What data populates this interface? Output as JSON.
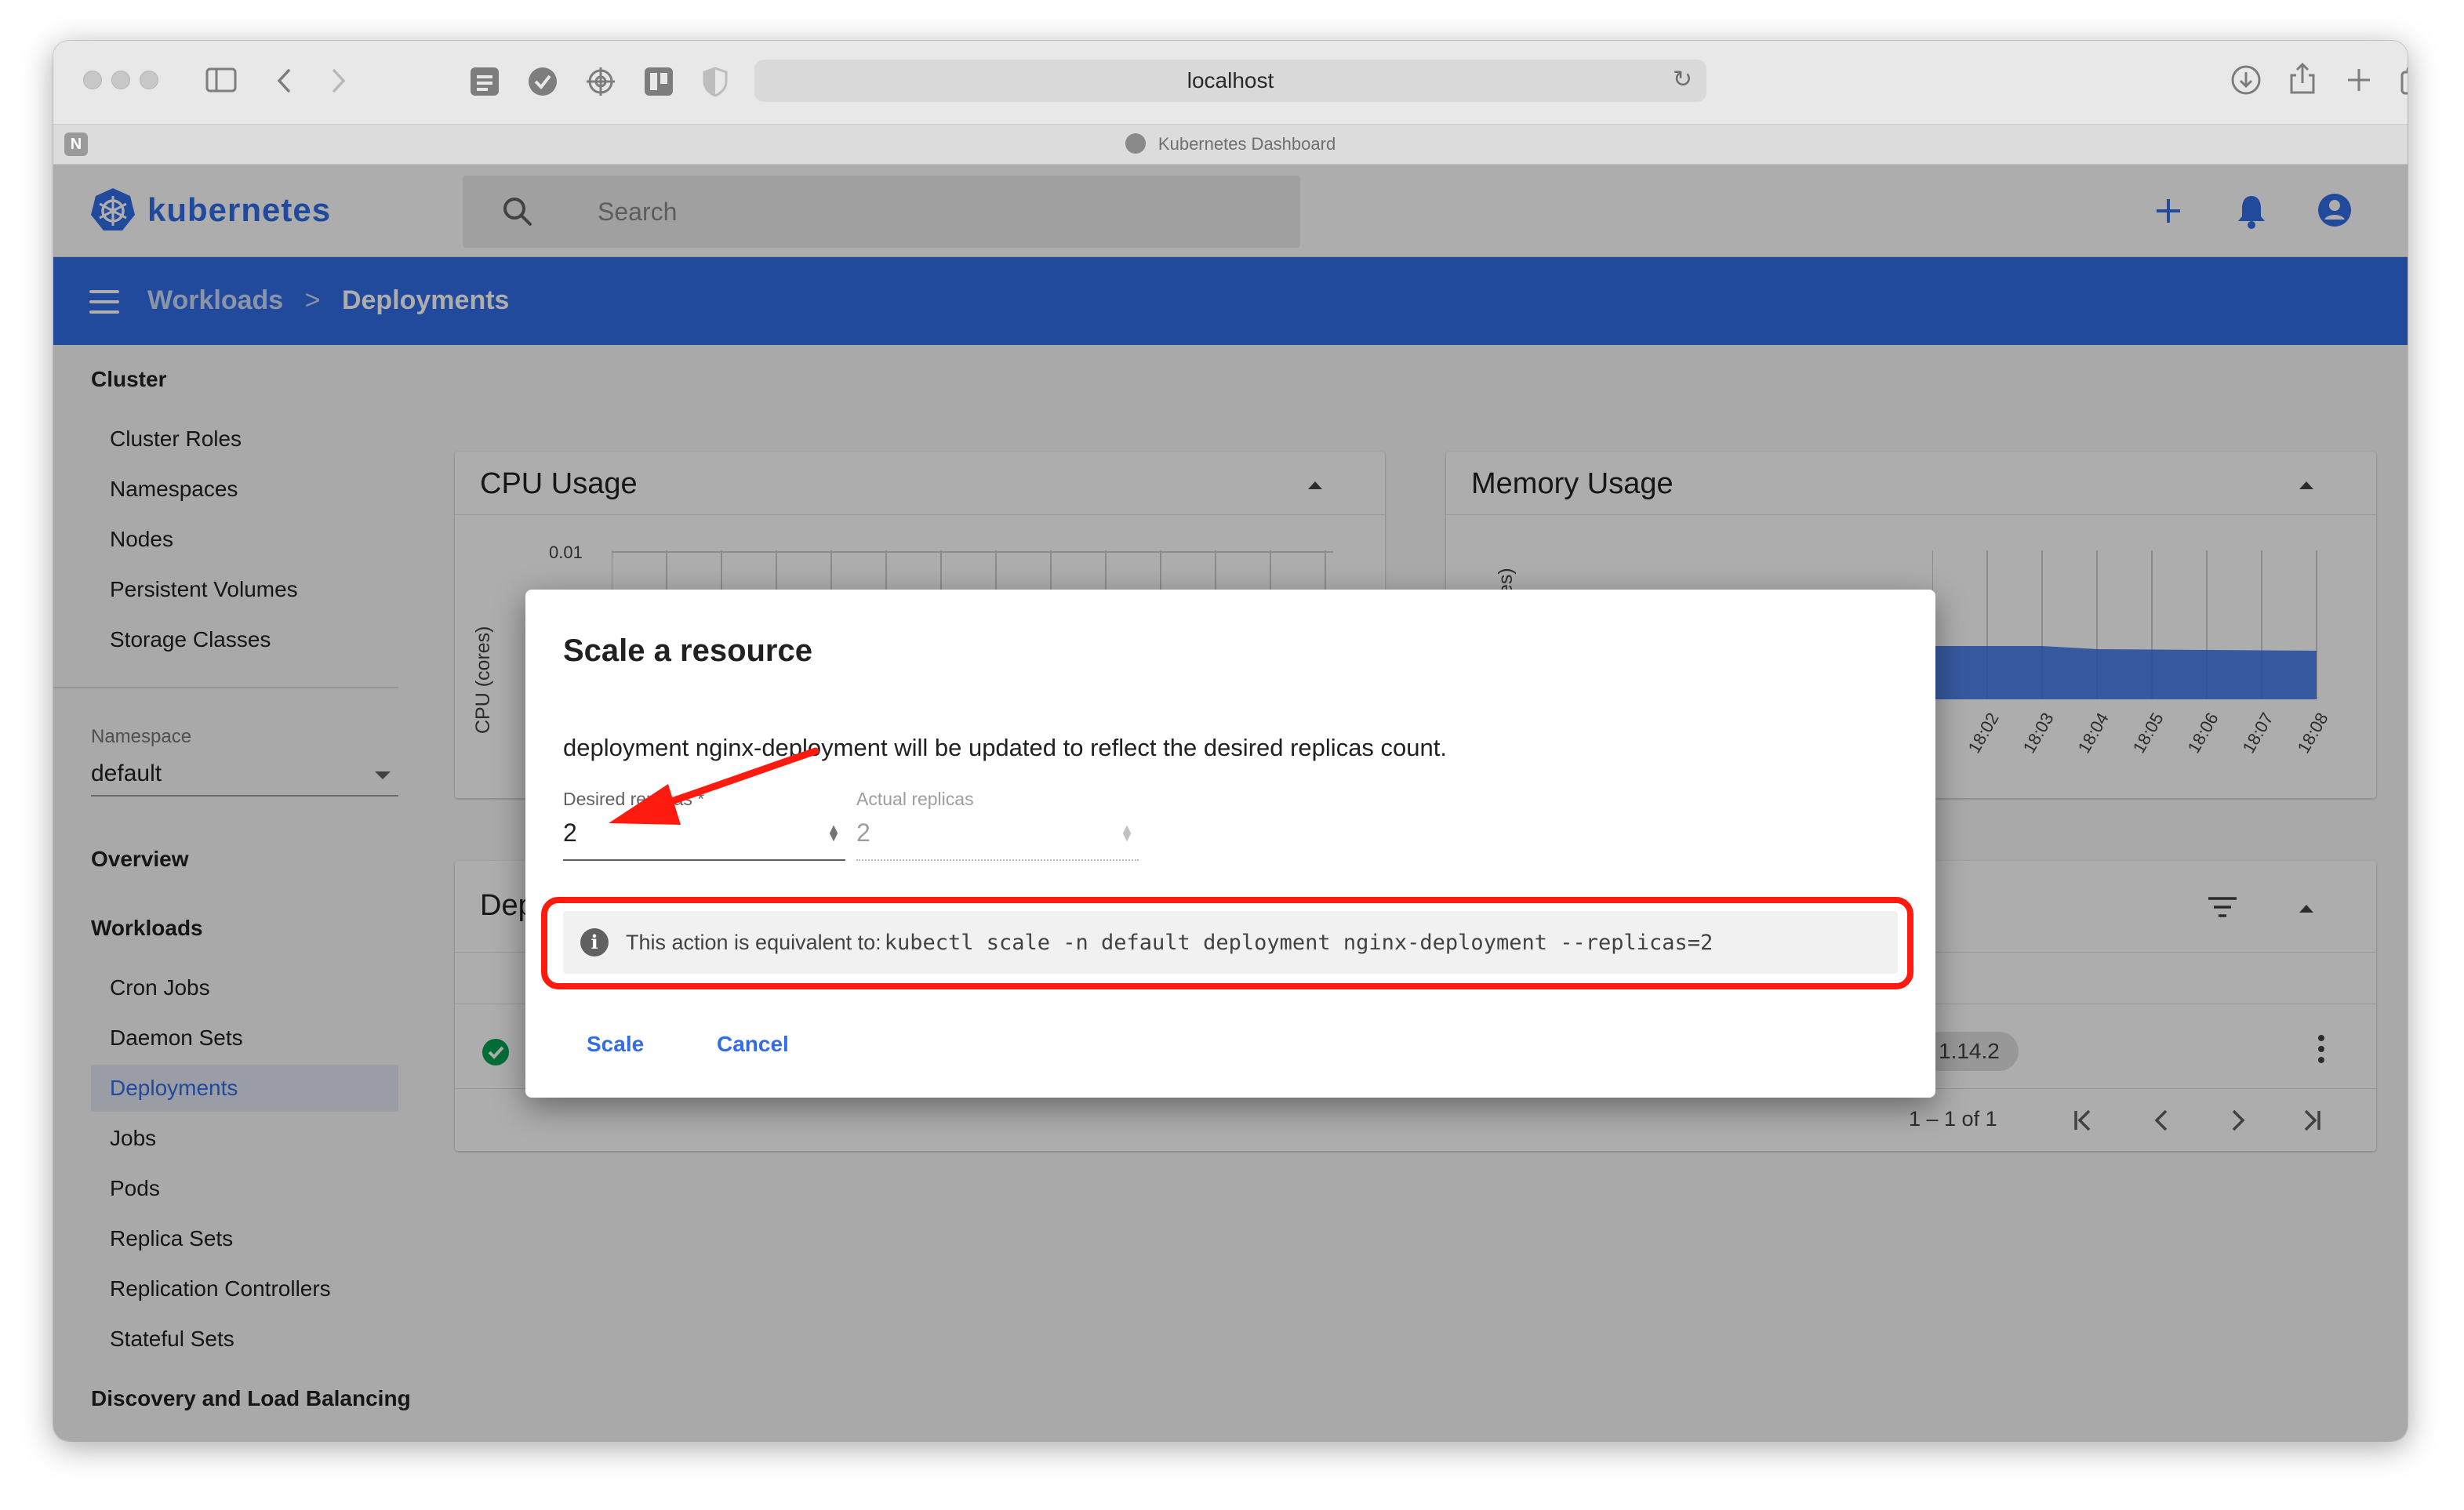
{
  "browser": {
    "url": "localhost",
    "tab_title": "Kubernetes Dashboard",
    "tab_badge": "N"
  },
  "app": {
    "logo_text": "kubernetes",
    "search_placeholder": "Search",
    "brand_color": "#326de6"
  },
  "breadcrumb": {
    "parent": "Workloads",
    "separator": ">",
    "current": "Deployments"
  },
  "sidebar": {
    "cluster_heading": "Cluster",
    "cluster_items": [
      "Cluster Roles",
      "Namespaces",
      "Nodes",
      "Persistent Volumes",
      "Storage Classes"
    ],
    "namespace_label": "Namespace",
    "namespace_value": "default",
    "overview": "Overview",
    "workloads_heading": "Workloads",
    "workloads_items": [
      "Cron Jobs",
      "Daemon Sets",
      "Deployments",
      "Jobs",
      "Pods",
      "Replica Sets",
      "Replication Controllers",
      "Stateful Sets"
    ],
    "active_item": "Deployments",
    "discovery_heading": "Discovery and Load Balancing"
  },
  "cards": {
    "cpu_title": "CPU Usage",
    "cpu_ylabel": "CPU (cores)",
    "cpu_ytick": "0.01",
    "memory_title": "Memory Usage",
    "memory_ylabel_fragment": "tes)",
    "memory_xticks": [
      "18:02",
      "18:03",
      "18:04",
      "18:05",
      "18:06",
      "18:07",
      "18:08"
    ],
    "deployments_title_fragment": "Dep",
    "image_fragment": "1.14.2",
    "pagination": "1 – 1 of 1"
  },
  "dialog": {
    "title": "Scale a resource",
    "message": "deployment nginx-deployment will be updated to reflect the desired replicas count.",
    "desired_label": "Desired replicas *",
    "desired_value": "2",
    "actual_label": "Actual replicas",
    "actual_value": "2",
    "info_prefix": "This action is equivalent to:",
    "info_command": "kubectl scale -n default deployment nginx-deployment --replicas=2",
    "scale_button": "Scale",
    "cancel_button": "Cancel",
    "highlight_color": "#ff1a0f"
  }
}
